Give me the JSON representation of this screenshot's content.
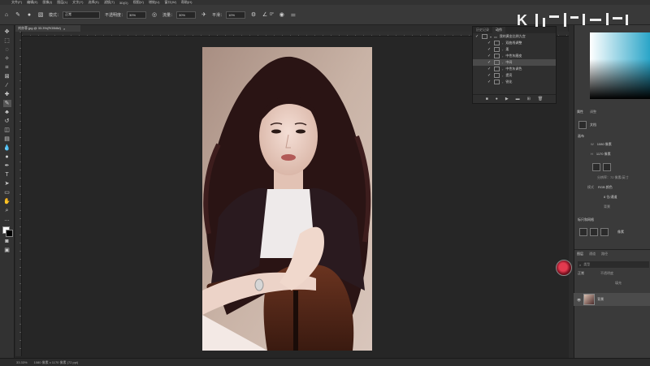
{
  "menubar": {
    "items": [
      "文件(F)",
      "编辑(E)",
      "图像(I)",
      "图层(L)",
      "文字(Y)",
      "选择(S)",
      "滤镜(T)",
      "3D(D)",
      "视图(V)",
      "增效(U)",
      "窗口(W)",
      "帮助(H)"
    ]
  },
  "options": {
    "mode_label": "模式：",
    "mode_value": "正常",
    "opacity_label": "不透明度：",
    "opacity_value": "30%",
    "flow_label": "流量：",
    "flow_value": "30%",
    "smooth_label": "平滑：",
    "smooth_value": "10%",
    "angle_value": "0°"
  },
  "document": {
    "tab_title": "刘亦菲.jpg @ 33.3%(RGB/8#)",
    "close_glyph": "×"
  },
  "history": {
    "tabs": [
      "历史记录",
      "动作"
    ],
    "rows": [
      {
        "label": "我的黄金比例九宫",
        "checked": true,
        "selected": false
      },
      {
        "label": "双曲线调整",
        "checked": true,
        "selected": false
      },
      {
        "label": "柔",
        "checked": true,
        "selected": false
      },
      {
        "label": "中性灰磨皮",
        "checked": true,
        "selected": false
      },
      {
        "label": "中间",
        "checked": true,
        "selected": true
      },
      {
        "label": "中性灰调色",
        "checked": true,
        "selected": false
      },
      {
        "label": "提亮",
        "checked": true,
        "selected": false
      },
      {
        "label": "锐化",
        "checked": true,
        "selected": false
      }
    ],
    "buttons": [
      "■",
      "●",
      "▶",
      "▬",
      "⊞",
      "🗑"
    ]
  },
  "properties": {
    "tabs": [
      "属性",
      "调整"
    ],
    "doc_label": "文档",
    "canvas_title": "画布",
    "width_label": "W",
    "width_value": "1080 像素",
    "height_label": "H",
    "height_value": "1170 像素",
    "resolution_label": "分辨率：72 像素/英寸",
    "mode_label": "模式",
    "mode_value": "RGB 颜色",
    "depth_value": "8 位/通道",
    "fill_label": "背景",
    "ruler_title": "标尺和网格",
    "unit_value": "像素"
  },
  "layers": {
    "tabs": [
      "图层",
      "通道",
      "路径"
    ],
    "search_placeholder": "类型",
    "blend_label": "正常",
    "opacity_label": "不透明度",
    "fill_label": "填充",
    "layer_name": "背景"
  },
  "status": {
    "zoom": "33.33%",
    "size": "1080 像素 x 1170 像素 (72 ppi)"
  },
  "watermark": {
    "letter": "K"
  }
}
